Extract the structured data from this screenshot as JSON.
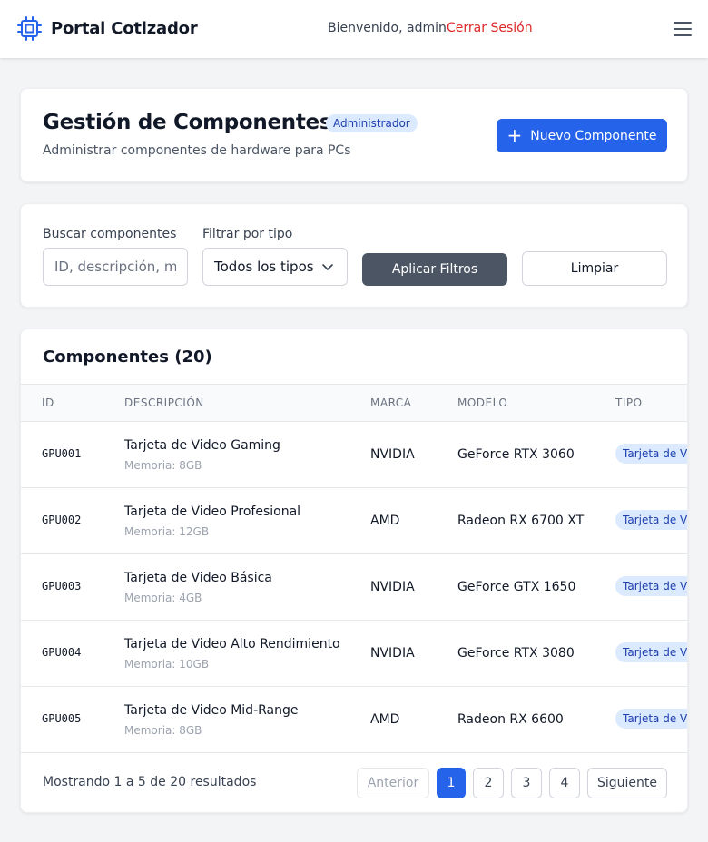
{
  "navbar": {
    "brand": "Portal Cotizador",
    "welcome": "Bienvenido, admin",
    "logout": "Cerrar Sesión"
  },
  "header": {
    "title": "Gestión de Componentes",
    "role_badge": "Administrador",
    "subtitle": "Administrar componentes de hardware para PCs",
    "new_button": "Nuevo Componente"
  },
  "filters": {
    "search_label": "Buscar componentes",
    "search_placeholder": "ID, descripción, marca...",
    "search_value": "",
    "type_label": "Filtrar por tipo",
    "type_selected": "Todos los tipos",
    "apply_button": "Aplicar Filtros",
    "clear_button": "Limpiar"
  },
  "list": {
    "title": "Componentes (20)",
    "columns": [
      "ID",
      "DESCRIPCIÓN",
      "MARCA",
      "MODELO",
      "TIPO"
    ],
    "rows": [
      {
        "id": "GPU001",
        "description": "Tarjeta de Video Gaming",
        "detail": "Memoria: 8GB",
        "brand": "NVIDIA",
        "model": "GeForce RTX 3060",
        "type": "Tarjeta de Video"
      },
      {
        "id": "GPU002",
        "description": "Tarjeta de Video Profesional",
        "detail": "Memoria: 12GB",
        "brand": "AMD",
        "model": "Radeon RX 6700 XT",
        "type": "Tarjeta de Video"
      },
      {
        "id": "GPU003",
        "description": "Tarjeta de Video Básica",
        "detail": "Memoria: 4GB",
        "brand": "NVIDIA",
        "model": "GeForce GTX 1650",
        "type": "Tarjeta de Video"
      },
      {
        "id": "GPU004",
        "description": "Tarjeta de Video Alto Rendimiento",
        "detail": "Memoria: 10GB",
        "brand": "NVIDIA",
        "model": "GeForce RTX 3080",
        "type": "Tarjeta de Video"
      },
      {
        "id": "GPU005",
        "description": "Tarjeta de Video Mid-Range",
        "detail": "Memoria: 8GB",
        "brand": "AMD",
        "model": "Radeon RX 6600",
        "type": "Tarjeta de Video"
      }
    ]
  },
  "pagination": {
    "summary": "Mostrando 1 a 5 de 20 resultados",
    "previous": "Anterior",
    "pages": [
      "1",
      "2",
      "3",
      "4"
    ],
    "current_page": "1",
    "next": "Siguiente"
  },
  "colors": {
    "primary": "#2563eb",
    "danger": "#dc2626",
    "badge_bg": "#dbeafe",
    "badge_text": "#1e40af"
  },
  "icons": {
    "brand": "chip-icon",
    "menu": "hamburger-menu-icon",
    "new": "plus-icon",
    "select": "chevron-down-icon"
  }
}
